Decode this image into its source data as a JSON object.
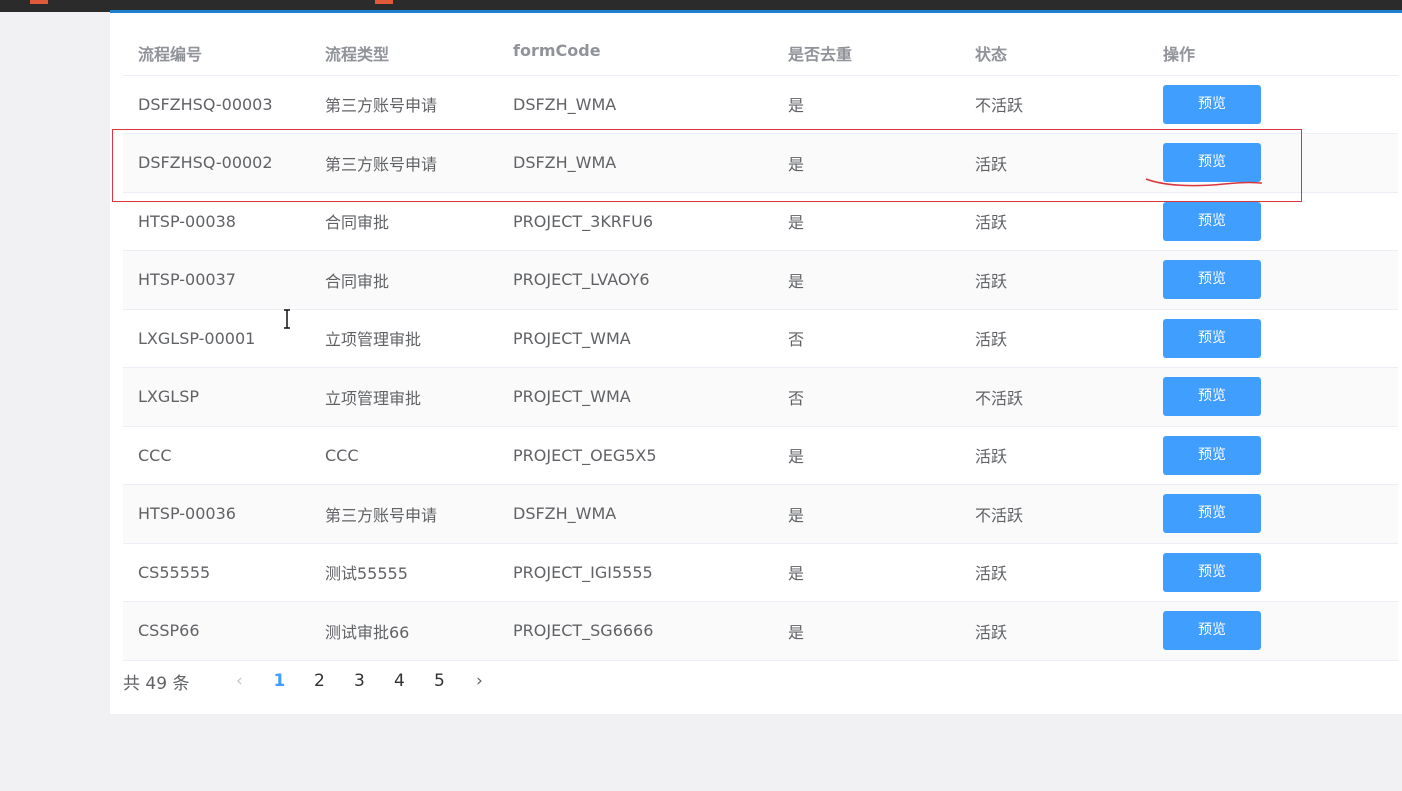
{
  "table": {
    "headers": [
      "流程编号",
      "流程类型",
      "formCode",
      "是否去重",
      "状态",
      "操作"
    ],
    "rows": [
      {
        "id": "DSFZHSQ-00003",
        "type": "第三方账号申请",
        "formCode": "DSFZH_WMA",
        "dedup": "是",
        "status": "不活跃",
        "action": "预览"
      },
      {
        "id": "DSFZHSQ-00002",
        "type": "第三方账号申请",
        "formCode": "DSFZH_WMA",
        "dedup": "是",
        "status": "活跃",
        "action": "预览"
      },
      {
        "id": "HTSP-00038",
        "type": "合同审批",
        "formCode": "PROJECT_3KRFU6",
        "dedup": "是",
        "status": "活跃",
        "action": "预览"
      },
      {
        "id": "HTSP-00037",
        "type": "合同审批",
        "formCode": "PROJECT_LVAOY6",
        "dedup": "是",
        "status": "活跃",
        "action": "预览"
      },
      {
        "id": "LXGLSP-00001",
        "type": "立项管理审批",
        "formCode": "PROJECT_WMA",
        "dedup": "否",
        "status": "活跃",
        "action": "预览"
      },
      {
        "id": "LXGLSP",
        "type": "立项管理审批",
        "formCode": "PROJECT_WMA",
        "dedup": "否",
        "status": "不活跃",
        "action": "预览"
      },
      {
        "id": "CCC",
        "type": "CCC",
        "formCode": "PROJECT_OEG5X5",
        "dedup": "是",
        "status": "活跃",
        "action": "预览"
      },
      {
        "id": "HTSP-00036",
        "type": "第三方账号申请",
        "formCode": "DSFZH_WMA",
        "dedup": "是",
        "status": "不活跃",
        "action": "预览"
      },
      {
        "id": "CS55555",
        "type": "测试55555",
        "formCode": "PROJECT_IGI5555",
        "dedup": "是",
        "status": "活跃",
        "action": "预览"
      },
      {
        "id": "CSSP66",
        "type": "测试审批66",
        "formCode": "PROJECT_SG6666",
        "dedup": "是",
        "status": "活跃",
        "action": "预览"
      }
    ]
  },
  "pagination": {
    "total_text": "共 49 条",
    "pages": [
      "1",
      "2",
      "3",
      "4",
      "5"
    ],
    "current": "1",
    "prev_glyph": "‹",
    "next_glyph": "›"
  },
  "colors": {
    "primary": "#409eff",
    "annotation": "#d9363e"
  }
}
